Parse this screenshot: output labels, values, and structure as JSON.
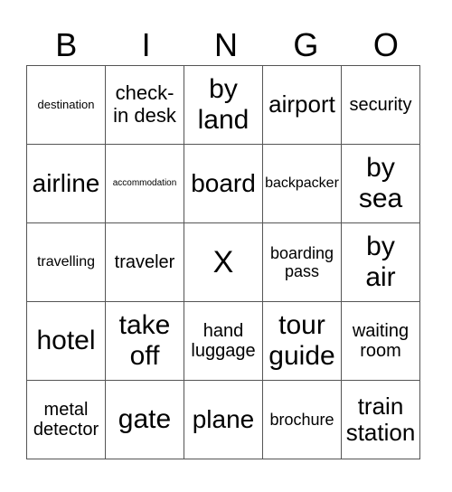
{
  "header": [
    "B",
    "I",
    "N",
    "G",
    "O"
  ],
  "grid": [
    [
      "destination",
      "check-\nin desk",
      "by\nland",
      "airport",
      "security"
    ],
    [
      "airline",
      "accommodation",
      "board",
      "backpacker",
      "by\nsea"
    ],
    [
      "travelling",
      "traveler",
      "X",
      "boarding\npass",
      "by\nair"
    ],
    [
      "hotel",
      "take\noff",
      "hand\nluggage",
      "tour\nguide",
      "waiting\nroom"
    ],
    [
      "metal\ndetector",
      "gate",
      "plane",
      "brochure",
      "train\nstation"
    ]
  ]
}
